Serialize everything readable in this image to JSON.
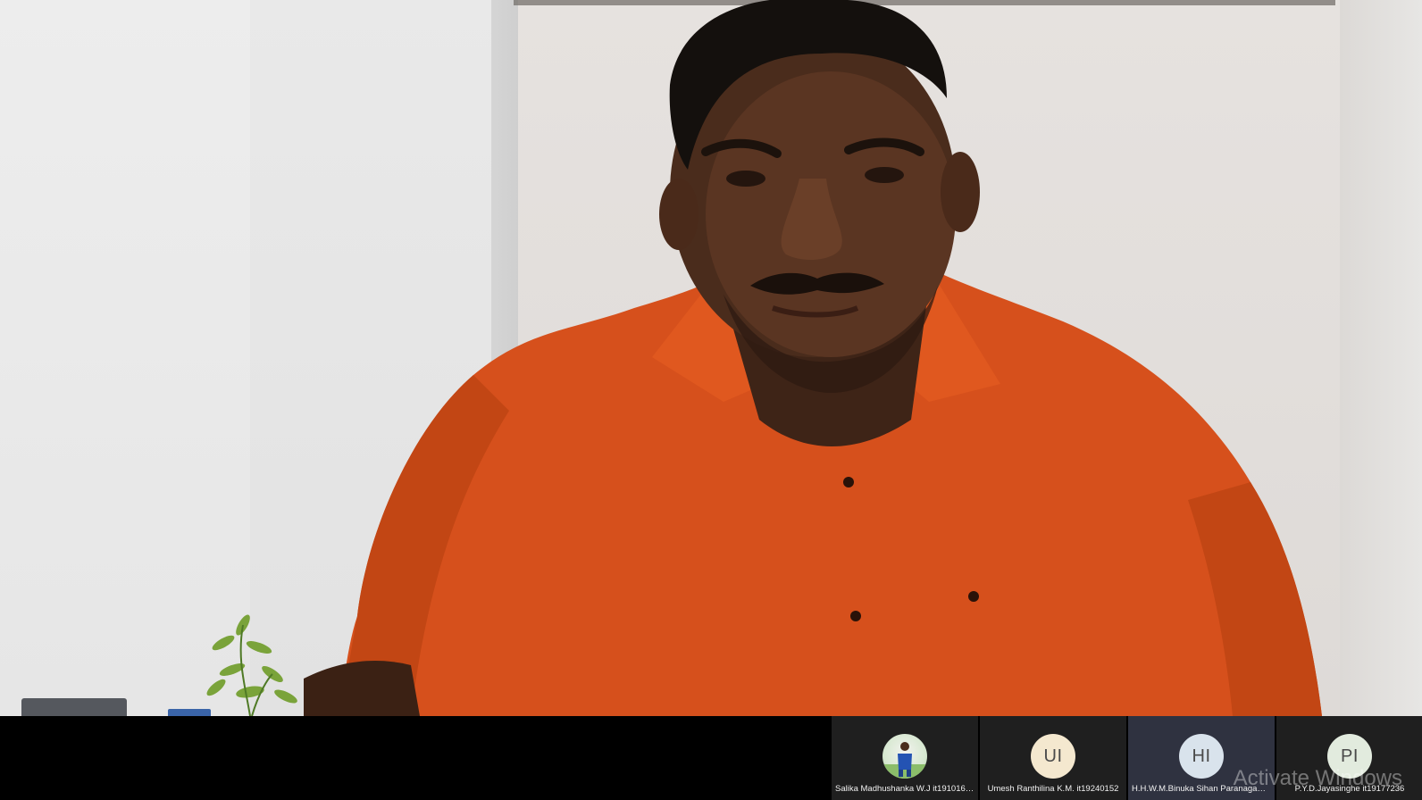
{
  "participants": [
    {
      "name": "Salika Madhushanka W.J it19101620",
      "initials": "",
      "avatar_type": "photo",
      "avatar_color": "#d6e8d0",
      "active": false
    },
    {
      "name": "Umesh Ranthilina K.M. it19240152",
      "initials": "UI",
      "avatar_type": "initials",
      "avatar_color": "#f4e8cf",
      "active": false
    },
    {
      "name": "H.H.W.M.Binuka Sihan Paranagama...",
      "initials": "HI",
      "avatar_type": "initials",
      "avatar_color": "#d9e3ec",
      "active": true
    },
    {
      "name": "P.Y.D.Jayasinghe it19177236",
      "initials": "PI",
      "avatar_type": "initials",
      "avatar_color": "#e2ebde",
      "active": false
    }
  ],
  "watermark": "Activate Windows",
  "colors": {
    "bar_background": "#000000",
    "tile_background": "#1f1f1f",
    "tile_active": "#2f3240",
    "shirt": "#d6501c"
  }
}
